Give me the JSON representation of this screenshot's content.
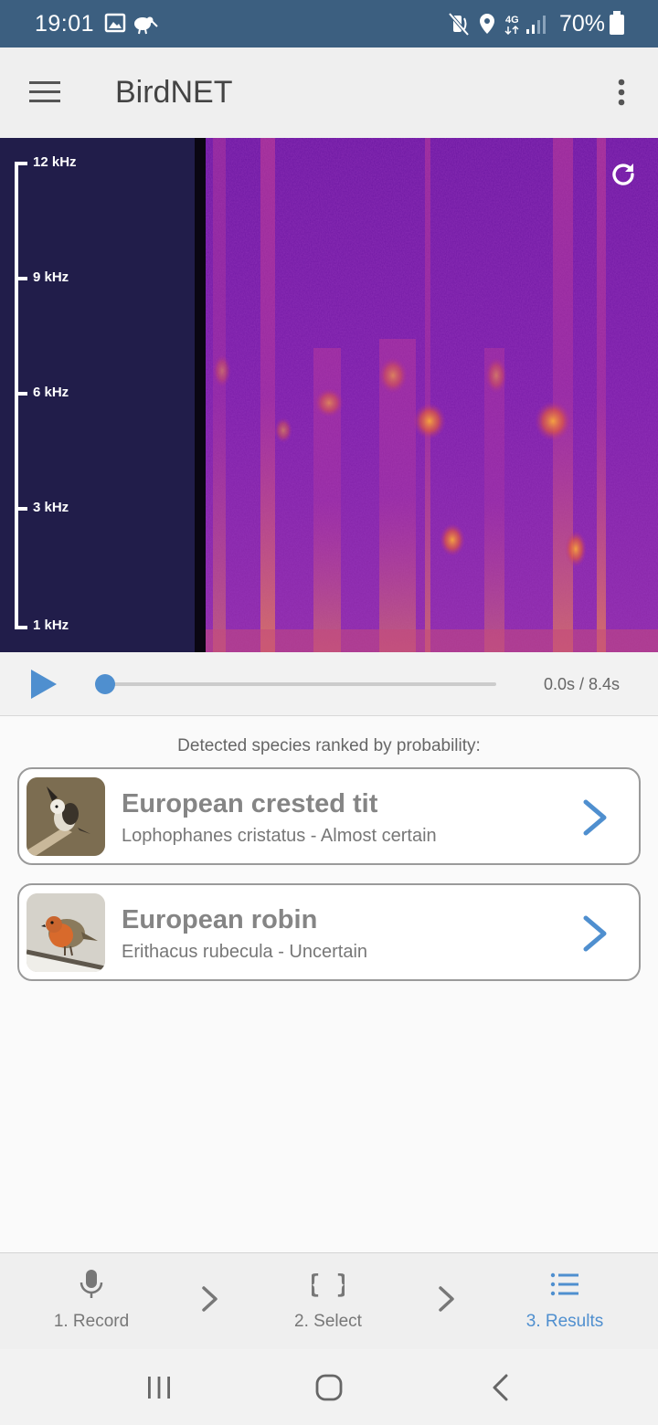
{
  "status_bar": {
    "time": "19:01",
    "battery": "70%",
    "network": "4G",
    "icons_left": [
      "image-icon",
      "kiwi-bird-icon"
    ],
    "icons_right": [
      "mute-vibrate-icon",
      "location-icon",
      "4g-icon",
      "signal-icon",
      "battery-icon"
    ]
  },
  "app_bar": {
    "title": "BirdNET",
    "menu_icon": "hamburger-menu-icon",
    "more_icon": "more-vert-icon"
  },
  "spectrogram": {
    "frequency_labels": [
      "12 kHz",
      "9 kHz",
      "6 kHz",
      "3 kHz",
      "1 kHz"
    ],
    "refresh_icon": "refresh-icon",
    "colors": {
      "axis_background": "#211d4a",
      "heat_low": "#5a10a8",
      "heat_mid": "#c23a9a",
      "heat_high": "#f7a23a"
    }
  },
  "player": {
    "play_icon": "play-icon",
    "timecode": "0.0s / 8.4s",
    "progress": 0.0
  },
  "results": {
    "heading": "Detected species ranked by probability:",
    "items": [
      {
        "common_name": "European crested tit",
        "details": "Lophophanes cristatus - Almost certain",
        "image_icon": "crested-tit-photo"
      },
      {
        "common_name": "European robin",
        "details": "Erithacus rubecula - Uncertain",
        "image_icon": "robin-photo"
      }
    ]
  },
  "bottom_nav": {
    "items": [
      {
        "label": "1. Record",
        "icon": "microphone-icon",
        "active": false
      },
      {
        "label": "2. Select",
        "icon": "curly-braces-icon",
        "active": false
      },
      {
        "label": "3. Results",
        "icon": "list-icon",
        "active": true
      }
    ],
    "accent": "#4f8fcf"
  },
  "system_nav": {
    "buttons": [
      "recent-apps-icon",
      "home-icon",
      "back-icon"
    ]
  }
}
